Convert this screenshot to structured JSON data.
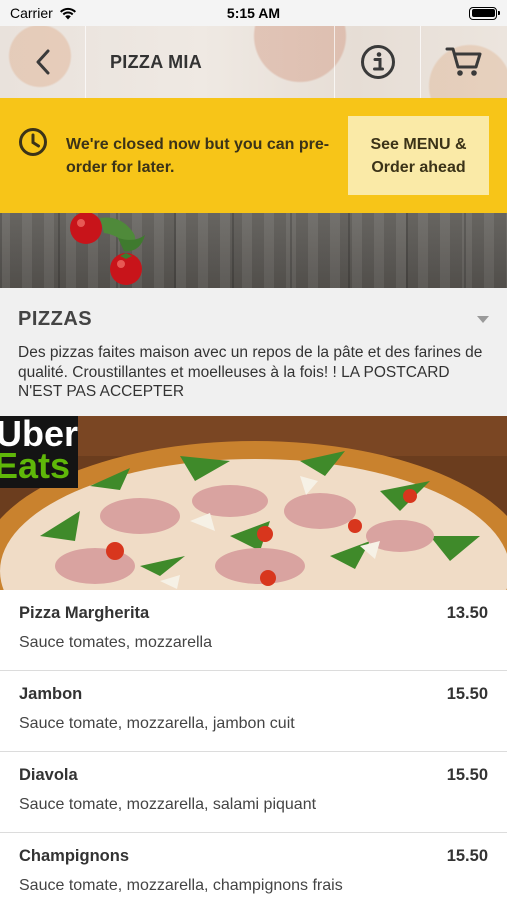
{
  "status_bar": {
    "carrier": "Carrier",
    "time": "5:15 AM"
  },
  "nav": {
    "title": "PIZZA MIA",
    "back_icon": "chevron-left-icon",
    "info_icon": "info-icon",
    "cart_icon": "cart-icon"
  },
  "banner": {
    "icon": "clock-icon",
    "message": "We're closed now but you can pre-order for later.",
    "button_label": "See MENU & Order ahead",
    "bg_color": "#f7c518"
  },
  "category": {
    "title": "PIZZAS",
    "description": "Des pizzas faites maison avec un repos de la pâte et des farines de qualité. Croustillantes et moelleuses à la fois! ! LA POSTCARD N'EST PAS ACCEPTER"
  },
  "hero": {
    "badge_line1": "Uber",
    "badge_line2": "Eats"
  },
  "menu_items": [
    {
      "name": "Pizza Margherita",
      "price": "13.50",
      "description": "Sauce tomates, mozzarella"
    },
    {
      "name": "Jambon",
      "price": "15.50",
      "description": "Sauce tomate, mozzarella, jambon cuit"
    },
    {
      "name": "Diavola",
      "price": "15.50",
      "description": "Sauce tomate, mozzarella, salami piquant"
    },
    {
      "name": "Champignons",
      "price": "15.50",
      "description": "Sauce tomate, mozzarella, champignons frais"
    }
  ]
}
